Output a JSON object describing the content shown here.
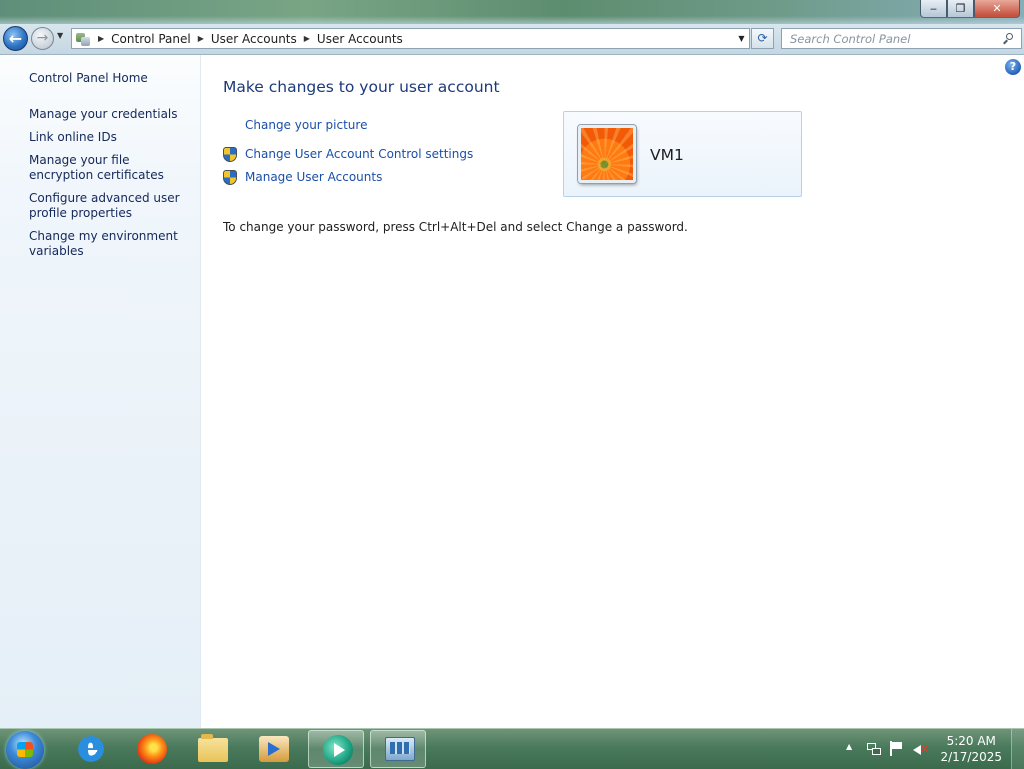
{
  "window": {
    "caption_buttons": {
      "minimize": "‒",
      "maximize": "❐",
      "close": "✕"
    }
  },
  "navbar": {
    "back_glyph": "←",
    "forward_glyph": "→",
    "breadcrumbs": [
      "Control Panel",
      "User Accounts",
      "User Accounts"
    ],
    "search_placeholder": "Search Control Panel"
  },
  "left_pane": {
    "home": "Control Panel Home",
    "tasks": [
      "Manage your credentials",
      "Link online IDs",
      "Manage your file encryption certificates",
      "Configure advanced user profile properties",
      "Change my environment variables"
    ]
  },
  "main": {
    "help_glyph": "?",
    "title": "Make changes to your user account",
    "links": [
      {
        "label": "Change your picture",
        "shield": false
      },
      {
        "label": "Change User Account Control settings",
        "shield": true
      },
      {
        "label": "Manage User Accounts",
        "shield": true
      }
    ],
    "account_name": "VM1",
    "password_info": "To change your password, press Ctrl+Alt+Del and select Change a password."
  },
  "taskbar": {
    "pinned": [
      "internet-explorer",
      "firefox",
      "windows-explorer",
      "media-player",
      "remote-desktop",
      "control-panel"
    ],
    "clock_time": "5:20 AM",
    "clock_date": "2/17/2025"
  },
  "colors": {
    "link": "#1a4fa8",
    "title": "#1d3a7a",
    "left_link": "#14285a",
    "taskbar": "#4a7a5c"
  }
}
